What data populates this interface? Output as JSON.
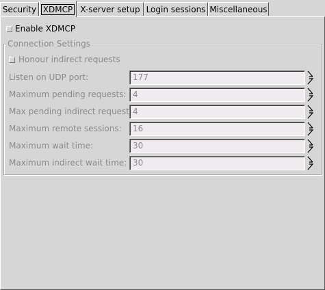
{
  "tabs": [
    {
      "label": "Security"
    },
    {
      "label": "XDMCP"
    },
    {
      "label": "X-server setup"
    },
    {
      "label": "Login sessions"
    },
    {
      "label": "Miscellaneous"
    }
  ],
  "active_tab": "XDMCP",
  "enable_xdmcp": {
    "label": "Enable XDMCP",
    "checked": false
  },
  "connection_settings": {
    "title": "Connection Settings",
    "honour_indirect": {
      "label": "Honour indirect requests",
      "checked": false
    },
    "rows": [
      {
        "label": "Listen on UDP port:",
        "value": "177"
      },
      {
        "label": "Maximum pending requests:",
        "value": "4"
      },
      {
        "label": "Max pending indirect requests:",
        "value": "4"
      },
      {
        "label": "Maximum remote sessions:",
        "value": "16"
      },
      {
        "label": "Maximum wait time:",
        "value": "30"
      },
      {
        "label": "Maximum indirect wait time:",
        "value": "30"
      }
    ]
  }
}
